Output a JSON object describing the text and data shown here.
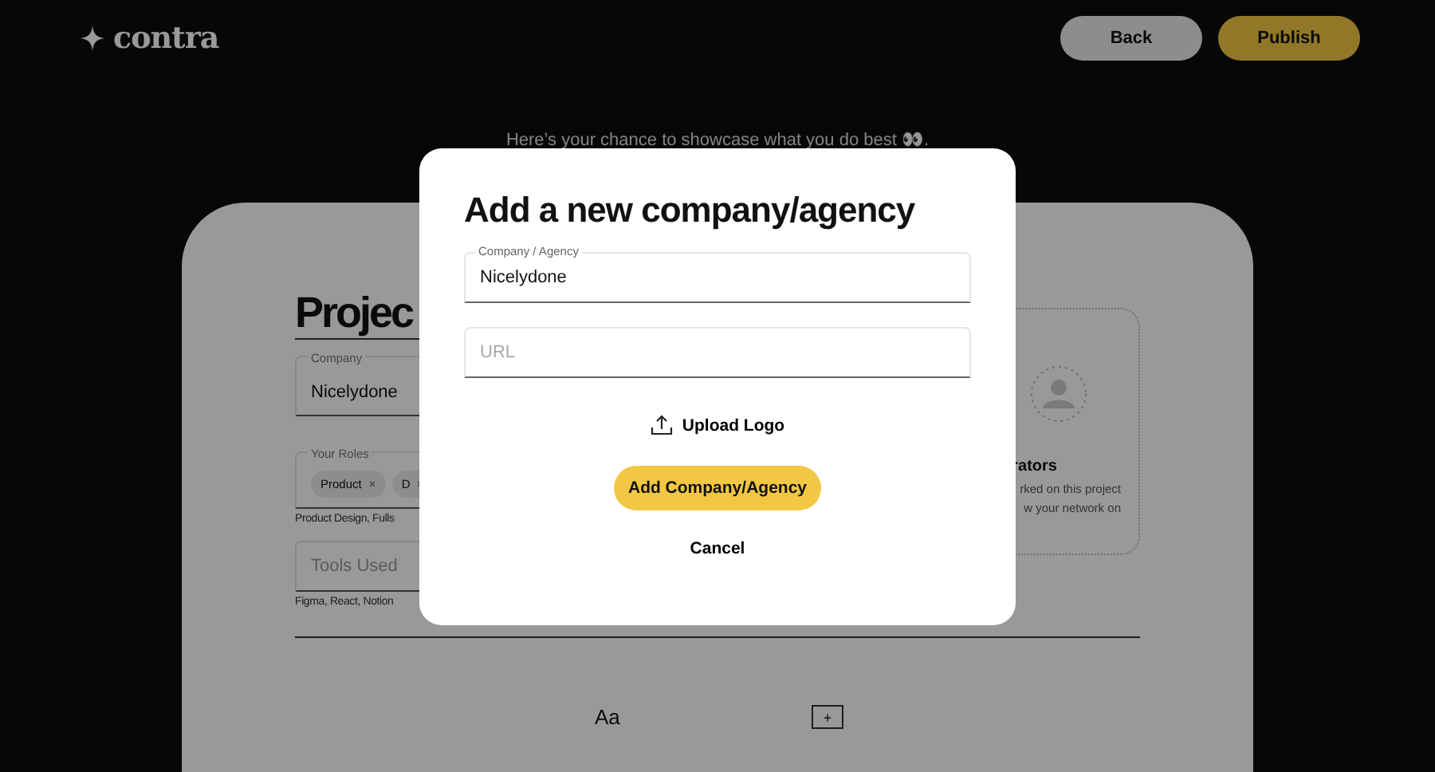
{
  "header": {
    "logo": "contra",
    "buttons": [
      {
        "label": "Back",
        "kind": "secondary"
      },
      {
        "label": "Publish",
        "kind": "primary"
      }
    ]
  },
  "tagline": "Here’s your chance to showcase what you do best 👀.",
  "project": {
    "title": "Projec",
    "company": {
      "label": "Company",
      "value": "Nicelydone"
    },
    "roles": {
      "label": "Your Roles",
      "chips": [
        "Product",
        "D"
      ],
      "helper": "Product Design, Fulls"
    },
    "tools": {
      "placeholder": "Tools Used",
      "helper": "Figma, React, Notion"
    }
  },
  "collaborators": {
    "title": "rators",
    "lines": [
      "rked on this project",
      "w your network on"
    ]
  },
  "editor": {
    "text_tool": "Aa",
    "add": "+"
  },
  "modal": {
    "title": "Add a new company/agency",
    "fields": [
      {
        "label": "Company / Agency",
        "value": "Nicelydone"
      },
      {
        "placeholder": "URL"
      }
    ],
    "upload": "Upload Logo",
    "submit": "Add Company/Agency",
    "cancel": "Cancel"
  }
}
